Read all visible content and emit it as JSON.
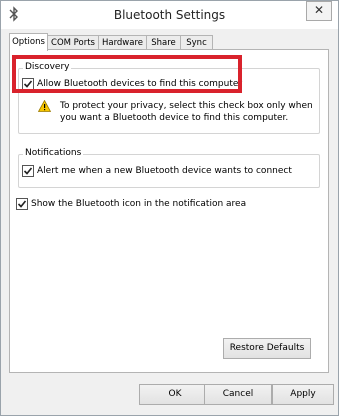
{
  "window": {
    "title": "Bluetooth Settings",
    "close_glyph": "✕"
  },
  "tabs": [
    {
      "label": "Options",
      "active": true
    },
    {
      "label": "COM Ports",
      "active": false
    },
    {
      "label": "Hardware",
      "active": false
    },
    {
      "label": "Share",
      "active": false
    },
    {
      "label": "Sync",
      "active": false
    }
  ],
  "discovery": {
    "legend": "Discovery",
    "checkbox_label": "Allow Bluetooth devices to find this computer",
    "checked": true,
    "warning_line1": "To protect your privacy, select this check box only when",
    "warning_line2": "you want a Bluetooth device to find this computer."
  },
  "notifications": {
    "legend": "Notifications",
    "checkbox_label": "Alert me when a new Bluetooth device wants to connect",
    "checked": true
  },
  "show_icon": {
    "checkbox_label": "Show the Bluetooth icon in the notification area",
    "checked": true
  },
  "buttons": {
    "restore_defaults": "Restore Defaults",
    "ok": "OK",
    "cancel": "Cancel",
    "apply": "Apply"
  },
  "colors": {
    "highlight": "#d9222c",
    "bluetooth": "#0a63c9"
  }
}
